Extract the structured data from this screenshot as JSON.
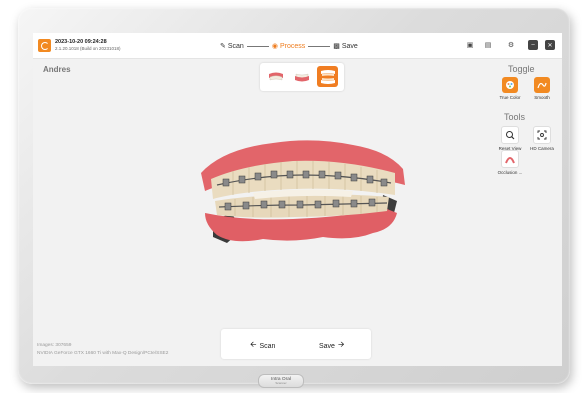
{
  "header": {
    "timestamp": "2023-10-20 09:24:28",
    "build": "2.1.20.1018 (Build on 20231018)",
    "steps": [
      {
        "label": "Scan",
        "icon": "scanner-icon",
        "active": false
      },
      {
        "label": "Process",
        "icon": "process-icon",
        "active": true
      },
      {
        "label": "Save",
        "icon": "save-icon",
        "active": false
      }
    ]
  },
  "patient": {
    "name": "Andres"
  },
  "view_selector": {
    "options": [
      "upper-jaw",
      "lower-jaw",
      "both-jaws"
    ],
    "selected": "both-jaws"
  },
  "right_panel": {
    "toggle_title": "Toggle",
    "toggle_items": [
      {
        "label": "True Color",
        "icon": "palette-icon"
      },
      {
        "label": "Smooth",
        "icon": "smooth-icon"
      }
    ],
    "tools_title": "Tools",
    "tools_items": [
      {
        "label": "Reset View",
        "icon": "magnifier-icon"
      },
      {
        "label": "HD Camera",
        "icon": "focus-icon"
      },
      {
        "label": "Occlusion ...",
        "icon": "occlusion-icon"
      }
    ]
  },
  "bottom_nav": {
    "back_label": "Scan",
    "next_label": "Save"
  },
  "status": {
    "images": "Images: 307659",
    "gpu": "NVIDIA GeForce GTX 1660 Ti with Max-Q Design/PCIe/SSE2"
  },
  "device": {
    "brand": "Intra Oral",
    "sub": "Scanner"
  },
  "colors": {
    "accent": "#f07d22",
    "gum": "#e2656a",
    "tooth": "#eadcc0"
  }
}
